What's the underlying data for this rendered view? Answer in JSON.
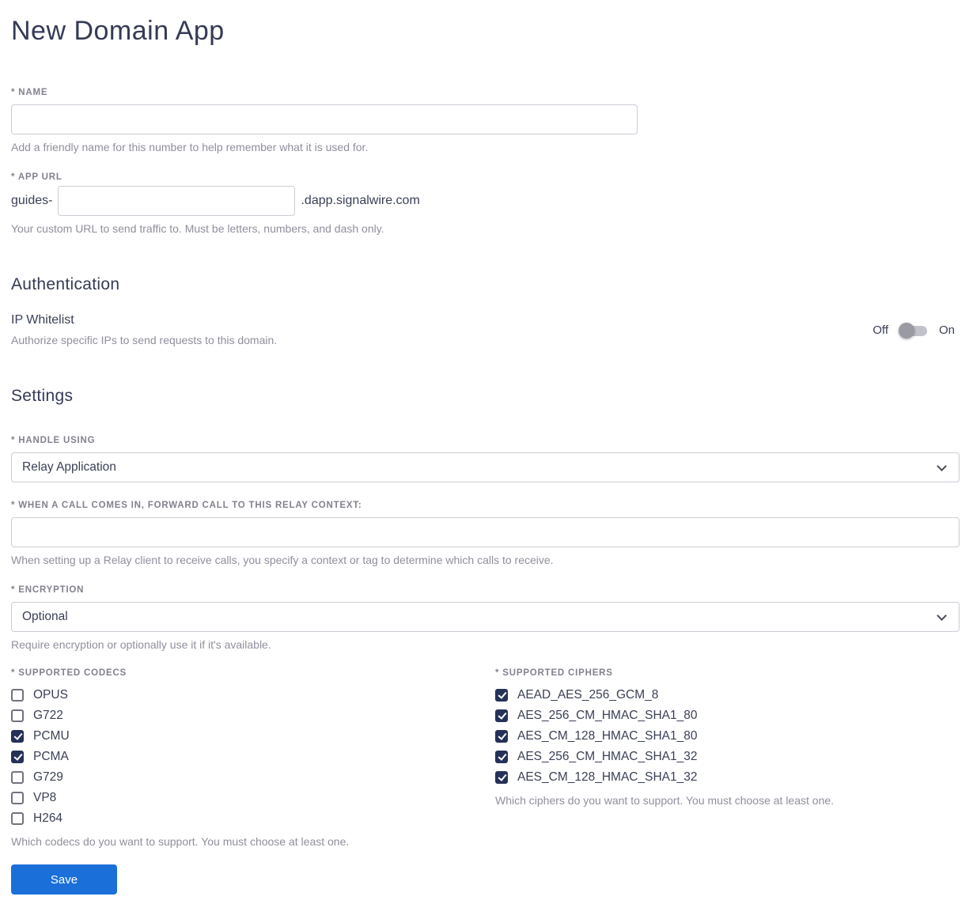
{
  "page": {
    "title": "New Domain App"
  },
  "name_field": {
    "label": "* NAME",
    "value": "",
    "helper": "Add a friendly name for this number to help remember what it is used for."
  },
  "app_url_field": {
    "label": "* APP URL",
    "prefix": "guides-",
    "value": "",
    "suffix": ".dapp.signalwire.com",
    "helper": "Your custom URL to send traffic to. Must be letters, numbers, and dash only."
  },
  "authentication": {
    "heading": "Authentication",
    "ip_whitelist": {
      "label": "IP Whitelist",
      "helper": "Authorize specific IPs to send requests to this domain.",
      "off_label": "Off",
      "on_label": "On",
      "state": "off"
    }
  },
  "settings": {
    "heading": "Settings",
    "handle_using": {
      "label": "* HANDLE USING",
      "value": "Relay Application"
    },
    "relay_context": {
      "label": "* WHEN A CALL COMES IN, FORWARD CALL TO THIS RELAY CONTEXT:",
      "value": "",
      "helper": "When setting up a Relay client to receive calls, you specify a context or tag to determine which calls to receive."
    },
    "encryption": {
      "label": "* ENCRYPTION",
      "value": "Optional",
      "helper": "Require encryption or optionally use it if it's available."
    },
    "codecs": {
      "label": "* SUPPORTED CODECS",
      "items": [
        {
          "label": "OPUS",
          "checked": false
        },
        {
          "label": "G722",
          "checked": false
        },
        {
          "label": "PCMU",
          "checked": true
        },
        {
          "label": "PCMA",
          "checked": true
        },
        {
          "label": "G729",
          "checked": false
        },
        {
          "label": "VP8",
          "checked": false
        },
        {
          "label": "H264",
          "checked": false
        }
      ],
      "helper": "Which codecs do you want to support. You must choose at least one."
    },
    "ciphers": {
      "label": "* SUPPORTED CIPHERS",
      "items": [
        {
          "label": "AEAD_AES_256_GCM_8",
          "checked": true
        },
        {
          "label": "AES_256_CM_HMAC_SHA1_80",
          "checked": true
        },
        {
          "label": "AES_CM_128_HMAC_SHA1_80",
          "checked": true
        },
        {
          "label": "AES_256_CM_HMAC_SHA1_32",
          "checked": true
        },
        {
          "label": "AES_CM_128_HMAC_SHA1_32",
          "checked": true
        }
      ],
      "helper": "Which ciphers do you want to support. You must choose at least one."
    }
  },
  "actions": {
    "save_label": "Save"
  },
  "colors": {
    "accent": "#1a6fd8",
    "checkbox": "#263159",
    "heading": "#353a55"
  }
}
